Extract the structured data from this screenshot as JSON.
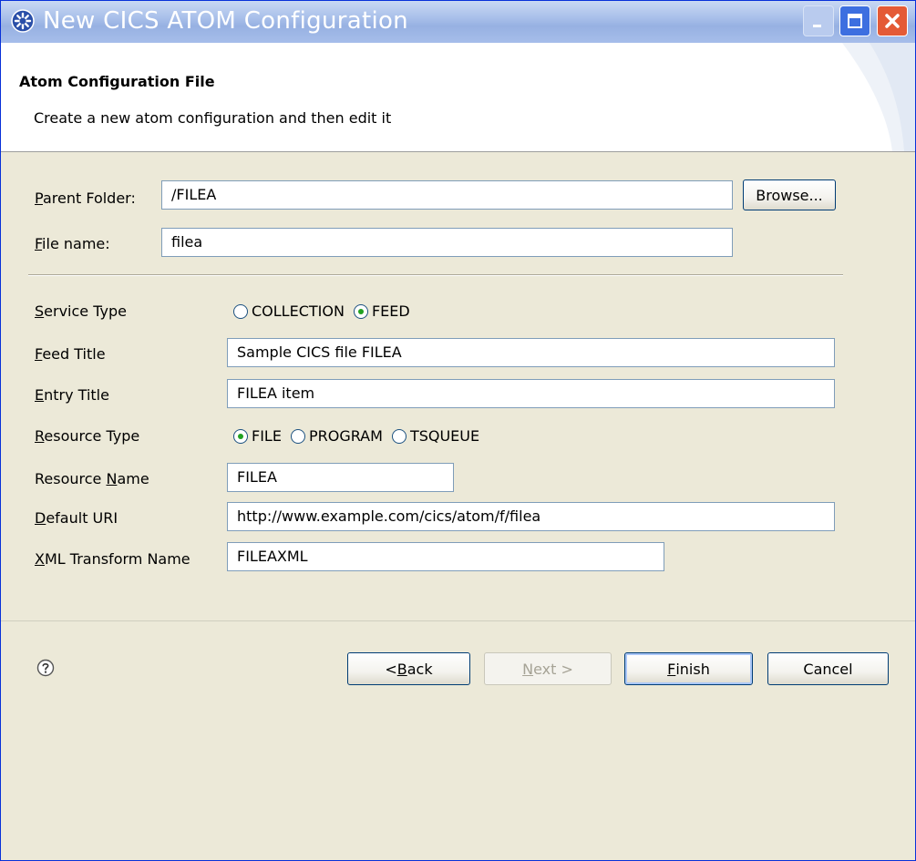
{
  "window": {
    "title": "New CICS ATOM Configuration",
    "icon": "gear-icon",
    "controls": {
      "minimize": "minimize-icon",
      "maximize": "maximize-icon",
      "close": "close-icon"
    }
  },
  "header": {
    "title": "Atom Configuration File",
    "description": "Create a new atom configuration and then edit it"
  },
  "form": {
    "parent_folder": {
      "label_mnemonic": "P",
      "label_rest": "arent Folder:",
      "value": "/FILEA"
    },
    "browse_label": "Browse...",
    "file_name": {
      "label_mnemonic": "F",
      "label_rest": "ile name:",
      "value": "filea"
    },
    "service_type": {
      "label_mnemonic": "S",
      "label_rest": "ervice Type",
      "options": [
        {
          "label": "COLLECTION",
          "selected": false
        },
        {
          "label": "FEED",
          "selected": true
        }
      ]
    },
    "feed_title": {
      "label_mnemonic": "F",
      "label_rest": "eed Title",
      "value": "Sample CICS file FILEA"
    },
    "entry_title": {
      "label_mnemonic": "E",
      "label_rest": "ntry Title",
      "value": "FILEA item"
    },
    "resource_type": {
      "label_mnemonic": "R",
      "label_rest": "esource Type",
      "options": [
        {
          "label": "FILE",
          "selected": true
        },
        {
          "label": "PROGRAM",
          "selected": false
        },
        {
          "label": "TSQUEUE",
          "selected": false
        }
      ]
    },
    "resource_name": {
      "label_pre": "Resource ",
      "label_mnemonic": "N",
      "label_rest": "ame",
      "value": "FILEA"
    },
    "default_uri": {
      "label_mnemonic": "D",
      "label_rest": "efault URI",
      "value": "http://www.example.com/cics/atom/f/filea"
    },
    "xml_transform": {
      "label_mnemonic": "X",
      "label_rest": "ML Transform Name",
      "value": "FILEAXML"
    }
  },
  "footer": {
    "help_icon": "help-icon",
    "back": {
      "prefix": "< ",
      "mnemonic": "B",
      "rest": "ack"
    },
    "next": {
      "mnemonic": "N",
      "rest": "ext >"
    },
    "finish": {
      "mnemonic": "F",
      "rest": "inish"
    },
    "cancel": "Cancel"
  },
  "colors": {
    "titlebar": "#a9c0ea",
    "dialog": "#ece9d8",
    "close": "#e45a36",
    "field_border": "#7f9db9"
  }
}
